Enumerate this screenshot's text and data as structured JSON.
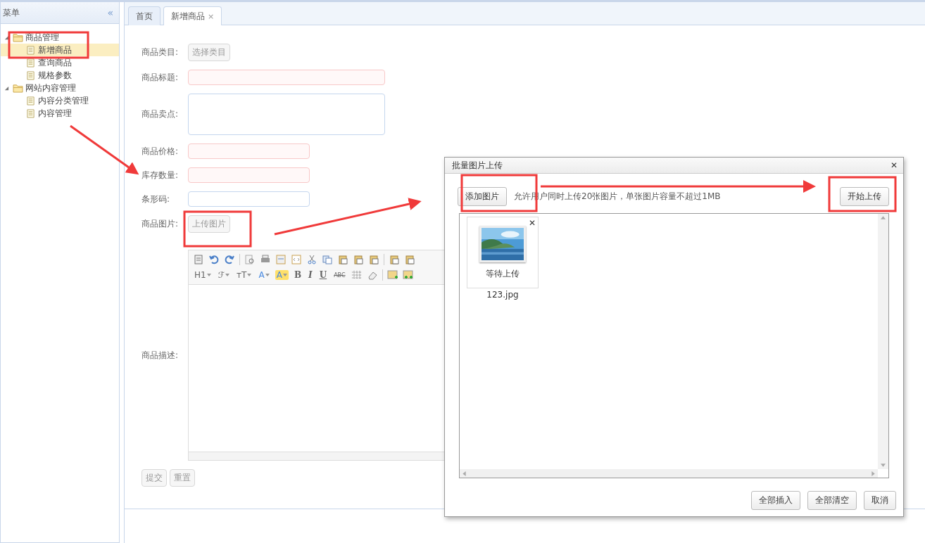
{
  "sidebar": {
    "title": "菜单",
    "collapse_glyph": "«",
    "tree": [
      {
        "label": "商品管理",
        "expanded": true,
        "selected": false,
        "children": [
          {
            "label": "新增商品",
            "selected": true
          },
          {
            "label": "查询商品",
            "selected": false
          },
          {
            "label": "规格参数",
            "selected": false
          }
        ]
      },
      {
        "label": "网站内容管理",
        "expanded": true,
        "selected": false,
        "children": [
          {
            "label": "内容分类管理",
            "selected": false
          },
          {
            "label": "内容管理",
            "selected": false
          }
        ]
      }
    ]
  },
  "tabs": [
    {
      "label": "首页",
      "selected": false,
      "closable": false
    },
    {
      "label": "新增商品",
      "selected": true,
      "closable": true,
      "close_glyph": "×"
    }
  ],
  "form": {
    "fields": [
      {
        "label": "商品类目:",
        "kind": "button",
        "text": "选择类目"
      },
      {
        "label": "商品标题:",
        "kind": "wide-input",
        "invalid": true
      },
      {
        "label": "商品卖点:",
        "kind": "textarea",
        "invalid": false
      },
      {
        "label": "商品价格:",
        "kind": "input",
        "invalid": true
      },
      {
        "label": "库存数量:",
        "kind": "input",
        "invalid": true
      },
      {
        "label": "条形码:",
        "kind": "input",
        "invalid": false
      },
      {
        "label": "商品图片:",
        "kind": "button",
        "text": "上传图片"
      },
      {
        "label": "商品描述:",
        "kind": "editor"
      }
    ],
    "editor_toolbar": [
      {
        "label": "H1",
        "kind": "dropdown"
      },
      {
        "label": "ℱ",
        "kind": "dropdown"
      },
      {
        "label": "тT",
        "kind": "dropdown"
      },
      {
        "label": "A",
        "kind": "dropdown"
      },
      {
        "label": "A",
        "kind": "highlight"
      },
      {
        "label": "B",
        "kind": "bold"
      },
      {
        "label": "I",
        "kind": "italic"
      },
      {
        "label": "U",
        "kind": "underline"
      },
      {
        "label": "ABC",
        "kind": "small"
      }
    ],
    "buttons": [
      "提交",
      "重置"
    ]
  },
  "dialog": {
    "title": "批量图片上传",
    "close_glyph": "✕",
    "add_button": "添加图片",
    "hint": "允许用户同时上传20张图片，单张图片容量不超过1MB",
    "start_button": "开始上传",
    "files": [
      {
        "status": "等待上传",
        "name": "123.jpg",
        "remove_glyph": "✕",
        "kind": "picture"
      }
    ],
    "buttons": [
      "全部插入",
      "全部清空",
      "取消"
    ]
  }
}
